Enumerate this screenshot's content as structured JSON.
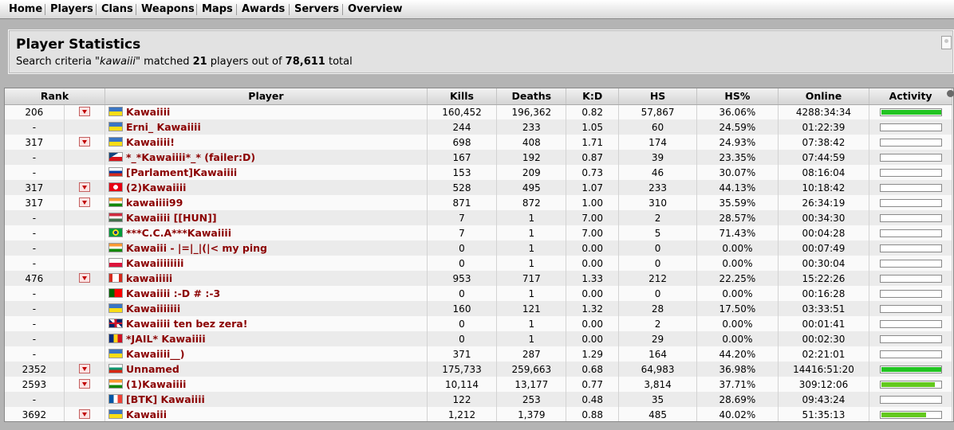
{
  "nav": [
    "Home",
    "Players",
    "Clans",
    "Weapons",
    "Maps",
    "Awards",
    "Servers",
    "Overview"
  ],
  "page": {
    "title": "Player Statistics",
    "search_prefix": "Search criteria \"",
    "search_term": "kawaiii",
    "search_mid": "\" matched ",
    "matched": "21",
    "search_mid2": " players out of ",
    "total": "78,611",
    "search_suffix": " total"
  },
  "columns": [
    "Rank",
    "Player",
    "Kills",
    "Deaths",
    "K:D",
    "HS",
    "HS%",
    "Online",
    "Activity"
  ],
  "colors": {
    "player_name": "#8b0000",
    "activity_high": "#22c422",
    "activity_mid": "#63c91e"
  },
  "rows": [
    {
      "rank": "206",
      "toggle": true,
      "flag": "ukraine",
      "name": "Kawaiiii",
      "kills": "160,452",
      "deaths": "196,362",
      "kd": "0.82",
      "hs": "57,867",
      "hsp": "36.06%",
      "online": "4288:34:34",
      "activity": 0.99
    },
    {
      "rank": "-",
      "toggle": false,
      "flag": "ukraine",
      "name": "Erni_ Kawaiiii",
      "kills": "244",
      "deaths": "233",
      "kd": "1.05",
      "hs": "60",
      "hsp": "24.59%",
      "online": "01:22:39",
      "activity": 0
    },
    {
      "rank": "317",
      "toggle": true,
      "flag": "ukraine",
      "name": "Kawaiiii!",
      "kills": "698",
      "deaths": "408",
      "kd": "1.71",
      "hs": "174",
      "hsp": "24.93%",
      "online": "07:38:42",
      "activity": 0
    },
    {
      "rank": "-",
      "toggle": false,
      "flag": "czech",
      "name": "*_*Kawaiiii*_* (failer:D)",
      "kills": "167",
      "deaths": "192",
      "kd": "0.87",
      "hs": "39",
      "hsp": "23.35%",
      "online": "07:44:59",
      "activity": 0
    },
    {
      "rank": "-",
      "toggle": false,
      "flag": "russia",
      "name": "[Parlament]Kawaiiii",
      "kills": "153",
      "deaths": "209",
      "kd": "0.73",
      "hs": "46",
      "hsp": "30.07%",
      "online": "08:16:04",
      "activity": 0
    },
    {
      "rank": "317",
      "toggle": true,
      "flag": "tunisia",
      "name": "(2)Kawaiiii",
      "kills": "528",
      "deaths": "495",
      "kd": "1.07",
      "hs": "233",
      "hsp": "44.13%",
      "online": "10:18:42",
      "activity": 0
    },
    {
      "rank": "317",
      "toggle": true,
      "flag": "india",
      "name": "kawaiiii99",
      "kills": "871",
      "deaths": "872",
      "kd": "1.00",
      "hs": "310",
      "hsp": "35.59%",
      "online": "26:34:19",
      "activity": 0
    },
    {
      "rank": "-",
      "toggle": false,
      "flag": "hungary",
      "name": "Kawaiiii [[HUN]]",
      "kills": "7",
      "deaths": "1",
      "kd": "7.00",
      "hs": "2",
      "hsp": "28.57%",
      "online": "00:34:30",
      "activity": 0
    },
    {
      "rank": "-",
      "toggle": false,
      "flag": "brazil",
      "name": "***C.C.A***Kawaiiii",
      "kills": "7",
      "deaths": "1",
      "kd": "7.00",
      "hs": "5",
      "hsp": "71.43%",
      "online": "00:04:28",
      "activity": 0
    },
    {
      "rank": "-",
      "toggle": false,
      "flag": "india",
      "name": "Kawaiii - |=|_|(|< my ping",
      "kills": "0",
      "deaths": "1",
      "kd": "0.00",
      "hs": "0",
      "hsp": "0.00%",
      "online": "00:07:49",
      "activity": 0
    },
    {
      "rank": "-",
      "toggle": false,
      "flag": "poland",
      "name": "Kawaiiiiiiii",
      "kills": "0",
      "deaths": "1",
      "kd": "0.00",
      "hs": "0",
      "hsp": "0.00%",
      "online": "00:30:04",
      "activity": 0
    },
    {
      "rank": "476",
      "toggle": true,
      "flag": "canada",
      "name": "kawaiiiii",
      "kills": "953",
      "deaths": "717",
      "kd": "1.33",
      "hs": "212",
      "hsp": "22.25%",
      "online": "15:22:26",
      "activity": 0
    },
    {
      "rank": "-",
      "toggle": false,
      "flag": "portugal",
      "name": "Kawaiiii :-D # :-3",
      "kills": "0",
      "deaths": "1",
      "kd": "0.00",
      "hs": "0",
      "hsp": "0.00%",
      "online": "00:16:28",
      "activity": 0
    },
    {
      "rank": "-",
      "toggle": false,
      "flag": "ukraine",
      "name": "Kawaiiiiiii",
      "kills": "160",
      "deaths": "121",
      "kd": "1.32",
      "hs": "28",
      "hsp": "17.50%",
      "online": "03:33:51",
      "activity": 0
    },
    {
      "rank": "-",
      "toggle": false,
      "flag": "uk",
      "name": "Kawaiiii ten bez zera!",
      "kills": "0",
      "deaths": "1",
      "kd": "0.00",
      "hs": "2",
      "hsp": "0.00%",
      "online": "00:01:41",
      "activity": 0
    },
    {
      "rank": "-",
      "toggle": false,
      "flag": "romania",
      "name": "*JAIL* Kawaiiii",
      "kills": "0",
      "deaths": "1",
      "kd": "0.00",
      "hs": "29",
      "hsp": "0.00%",
      "online": "00:02:30",
      "activity": 0
    },
    {
      "rank": "-",
      "toggle": false,
      "flag": "ukraine",
      "name": "Kawaiiii__)",
      "kills": "371",
      "deaths": "287",
      "kd": "1.29",
      "hs": "164",
      "hsp": "44.20%",
      "online": "02:21:01",
      "activity": 0
    },
    {
      "rank": "2352",
      "toggle": true,
      "flag": "bulgaria",
      "name": "Unnamed",
      "kills": "175,733",
      "deaths": "259,663",
      "kd": "0.68",
      "hs": "64,983",
      "hsp": "36.98%",
      "online": "14416:51:20",
      "activity": 0.99
    },
    {
      "rank": "2593",
      "toggle": true,
      "flag": "india",
      "name": "(1)Kawaiiii",
      "kills": "10,114",
      "deaths": "13,177",
      "kd": "0.77",
      "hs": "3,814",
      "hsp": "37.71%",
      "online": "309:12:06",
      "activity": 0.88
    },
    {
      "rank": "-",
      "toggle": false,
      "flag": "france",
      "name": "[BTK] Kawaiiii",
      "kills": "122",
      "deaths": "253",
      "kd": "0.48",
      "hs": "35",
      "hsp": "28.69%",
      "online": "09:43:24",
      "activity": 0
    },
    {
      "rank": "3692",
      "toggle": true,
      "flag": "ukraine",
      "name": "Kawaiii",
      "kills": "1,212",
      "deaths": "1,379",
      "kd": "0.88",
      "hs": "485",
      "hsp": "40.02%",
      "online": "51:35:13",
      "activity": 0.74
    }
  ]
}
